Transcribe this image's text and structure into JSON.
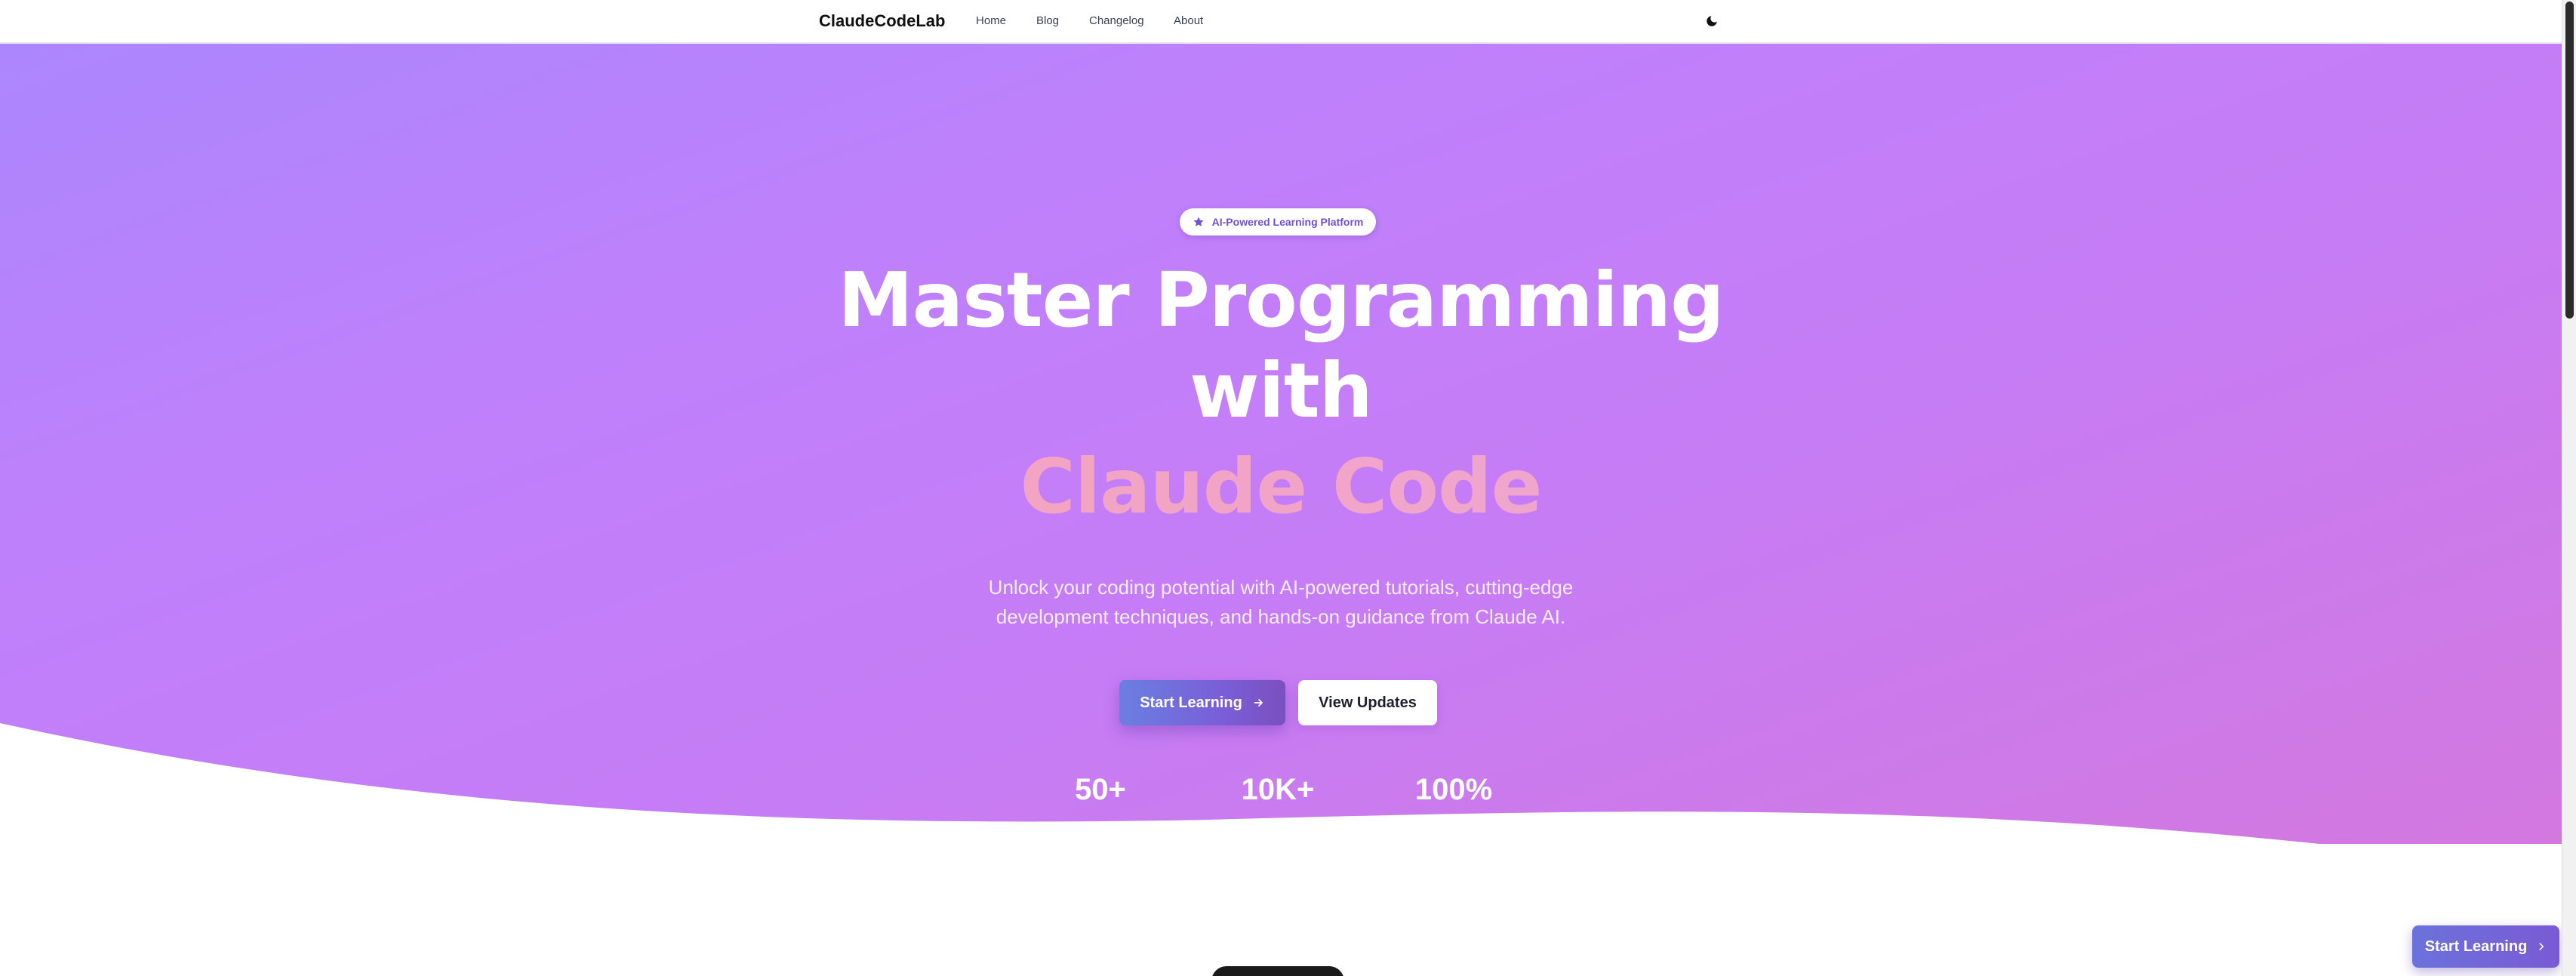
{
  "nav": {
    "brand": "ClaudeCodeLab",
    "links": [
      "Home",
      "Blog",
      "Changelog",
      "About"
    ],
    "theme_icon": "moon-icon"
  },
  "hero": {
    "badge_icon": "star-icon",
    "badge": "AI-Powered Learning Platform",
    "headline_line1": "Master Programming",
    "headline_line2": "with",
    "headline_highlight": "Claude Code",
    "subtitle": "Unlock your coding potential with AI-powered tutorials, cutting-edge development techniques, and hands-on guidance from Claude AI.",
    "primary_button": "Start Learning",
    "primary_button_icon": "arrow-right-icon",
    "secondary_button": "View Updates",
    "stats": [
      {
        "value": "50+"
      },
      {
        "value": "10K+"
      },
      {
        "value": "100%"
      }
    ]
  },
  "floating_cta": {
    "label": "Start Learning",
    "icon": "chevron-right-icon"
  },
  "colors": {
    "gradient_start": "#ac86fd",
    "gradient_end": "#d378df",
    "badge_text": "#6d4fd8",
    "highlight_start": "#f7b07c",
    "highlight_end": "#e8a9e3",
    "primary_button": "#7a5fd8"
  }
}
